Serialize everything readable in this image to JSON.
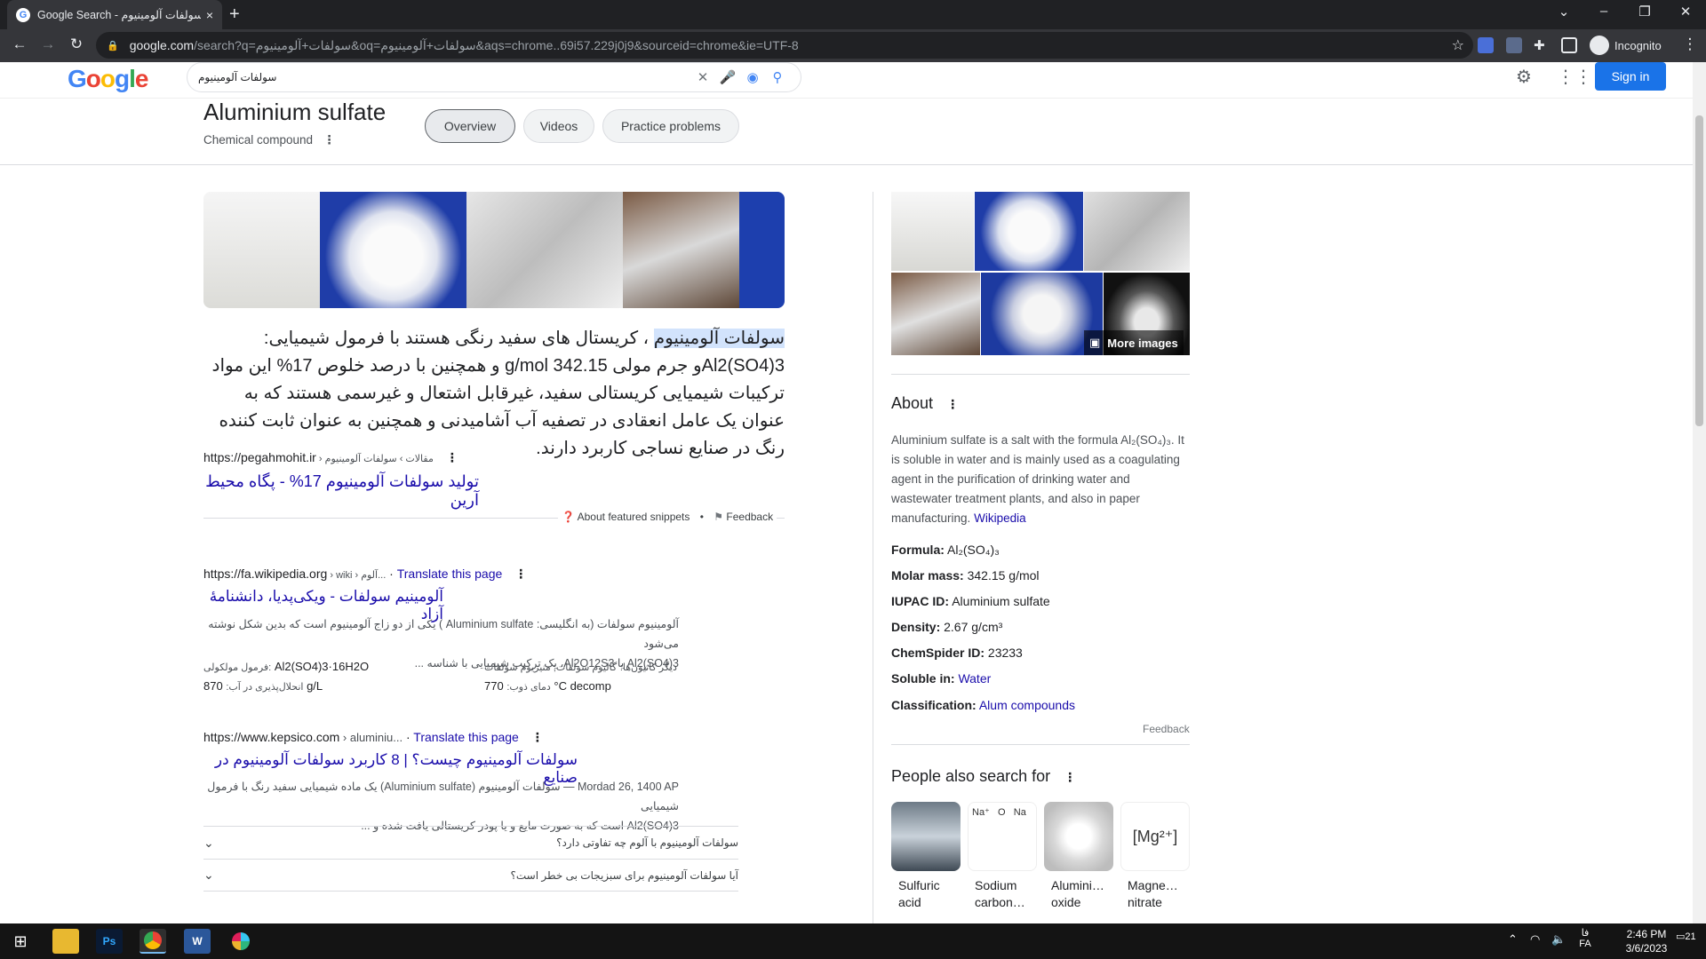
{
  "browser": {
    "tab_title": "Google Search - سولفات آلومینیوم",
    "url_host": "google.com",
    "url_rest": "/search?q=سولفات+آلومینیوم&oq=سولفات+آلومینیوم&aqs=chrome..69i57.229j0j9&sourceid=chrome&ie=UTF-8",
    "incognito_label": "Incognito",
    "new_tab": "+",
    "close_tab": "×"
  },
  "google": {
    "logo": "Google",
    "query": "سولفات آلومینیوم",
    "signin_label": "Sign in"
  },
  "entity": {
    "name": "Aluminium sulfate",
    "type": "Chemical compound",
    "tabs": [
      "Overview",
      "Videos",
      "Practice problems"
    ]
  },
  "snippet": {
    "highlight": "سولفات آلومینیوم",
    "text": "، کریستال های سفید رنگی هستند با فرمول شیمیایی: Al2(SO4)3و جرم مولی 342.15 g/mol و همچنین با درصد خلوص 17% این مواد ترکیبات شیمیایی کریستالی سفید، غیرقابل اشتعال و غیرسمی هستند که به عنوان یک عامل انعقادی در تصفیه آب آشامیدنی و همچنین به عنوان ثابت کننده رنگ در صنایع نساجی کاربرد دارند.",
    "source_url": "https://pegahmohit.ir",
    "source_path": " › مقالات › سولفات آلومینیوم",
    "title": "تولید سولفات آلومینیوم 17% - پگاه محیط آرین",
    "about": "About featured snippets",
    "feedback": "Feedback"
  },
  "result1": {
    "url": "https://fa.wikipedia.org",
    "path": " › wiki › آلوم...",
    "translate": "Translate this page",
    "title": "آلومینیم سولفات - ویکی‌پدیا، دانشنامهٔ آزاد",
    "desc1": "آلومینیوم سولفات (به انگلیسی: Aluminium sulfate ) یکی از دو زاج آلومینیوم است که بدین شکل نوشته می‌شود",
    "desc2": "Al2(SO4)3 یا Al2O12S3، یک ترکیب شیمیایی با شناسه ...",
    "facts": [
      {
        "label": "فرمول مولکولی:",
        "value": "Al2(SO4)3·16H2O"
      },
      {
        "label": "دیگر کاتیون‌ها:",
        "value": "گالیوم سولفات; منیزیوم سولفات"
      },
      {
        "label": "انحلال‌پذیری در آب:",
        "value": "870 g/L"
      },
      {
        "label": "دمای ذوب:",
        "value": "770 °C decomp"
      }
    ]
  },
  "result2": {
    "url": "https://www.kepsico.com",
    "path": " › aluminiu...",
    "translate": "Translate this page",
    "title": "سولفات آلومینیوم چیست؟ | 8 کاربرد سولفات آلومینیوم در صنایع",
    "desc1": "Mordad 26, 1400 AP — سولفات آلومینیوم (Aluminium sulfate) یک ماده شیمیایی سفید رنگ با فرمول شیمیایی",
    "desc2": "Al2(SO4)3 است که به صورت مایع و یا پودر کریستالی یافت شده و ..."
  },
  "faq": [
    "سولفات آلومینیوم با آلوم چه تفاوتی دارد؟",
    "آیا سولفات آلومینیوم برای سبزیجات بی خطر است؟"
  ],
  "panel": {
    "more_images": "More images",
    "about_title": "About",
    "about_text": "Aluminium sulfate is a salt with the formula Al₂(SO₄)₃. It is soluble in water and is mainly used as a coagulating agent in the purification of drinking water and wastewater treatment plants, and also in paper manufacturing.",
    "about_link": "Wikipedia",
    "facts": [
      {
        "label": "Formula:",
        "value": "Al₂(SO₄)₃",
        "link": false
      },
      {
        "label": "Molar mass:",
        "value": "342.15 g/mol",
        "link": false
      },
      {
        "label": "IUPAC ID:",
        "value": "Aluminium sulfate",
        "link": false
      },
      {
        "label": "Density:",
        "value": "2.67 g/cm³",
        "link": false
      },
      {
        "label": "ChemSpider ID:",
        "value": "23233",
        "link": false
      },
      {
        "label": "Soluble in:",
        "value": "Water",
        "link": true
      },
      {
        "label": "Classification:",
        "value": "Alum compounds",
        "link": true
      }
    ],
    "feedback": "Feedback",
    "people_title": "People also search for",
    "people": [
      {
        "l1": "Sulfuric",
        "l2": "acid"
      },
      {
        "l1": "Sodium",
        "l2": "carbon…"
      },
      {
        "l1": "Alumini…",
        "l2": "oxide"
      },
      {
        "l1": "Magne…",
        "l2": "nitrate"
      }
    ]
  },
  "taskbar": {
    "time": "2:46 PM",
    "date": "3/6/2023",
    "lang_top": "فا",
    "lang": "FA",
    "notif": "21"
  },
  "colors": {
    "link": "#1a0dab",
    "accent": "#1a73e8",
    "chrome_dark": "#202124"
  }
}
